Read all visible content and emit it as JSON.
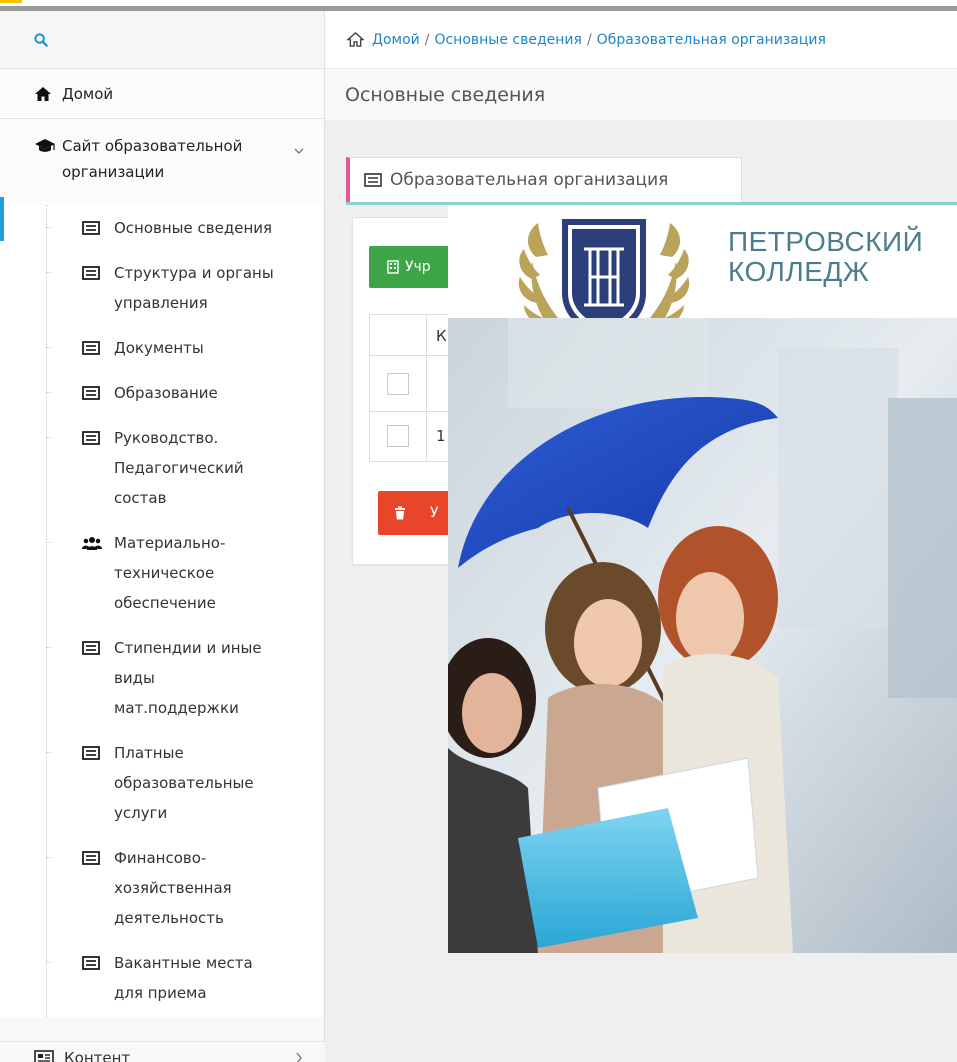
{
  "sidebar": {
    "search_icon": "search-icon",
    "home_label": "Домой",
    "site_label_line1": "Сайт образовательной",
    "site_label_line2": "организации",
    "items": [
      {
        "lines": [
          "Основные сведения"
        ],
        "icon": "list-icon",
        "active": true
      },
      {
        "lines": [
          "Структура и органы",
          "управления"
        ],
        "icon": "list-icon"
      },
      {
        "lines": [
          "Документы"
        ],
        "icon": "list-icon"
      },
      {
        "lines": [
          "Образование"
        ],
        "icon": "list-icon"
      },
      {
        "lines": [
          "Руководство.",
          "Педагогический",
          "состав"
        ],
        "icon": "list-icon"
      },
      {
        "lines": [
          "Материально-",
          "техническое",
          "обеспечение"
        ],
        "icon": "users-icon"
      },
      {
        "lines": [
          "Стипендии и иные",
          "виды",
          "мат.поддержки"
        ],
        "icon": "list-icon"
      },
      {
        "lines": [
          "Платные",
          "образовательные",
          "услуги"
        ],
        "icon": "list-icon"
      },
      {
        "lines": [
          "Финансово-",
          "хозяйственная",
          "деятельность"
        ],
        "icon": "list-icon"
      },
      {
        "lines": [
          "Вакантные места",
          "для приема"
        ],
        "icon": "list-icon"
      }
    ],
    "content_label": "Контент"
  },
  "breadcrumb": {
    "home": "Домой",
    "section": "Основные сведения",
    "current": "Образовательная организация",
    "separator": "/"
  },
  "page_header": "Основные сведения",
  "tab_label": "Образовательная организация",
  "card": {
    "green_button": "Учр",
    "table_header": "К",
    "row_value": "1",
    "red_button": "У"
  },
  "overlay": {
    "college_line1": "ПЕТРОВСКИЙ",
    "college_line2": "КОЛЛЕДЖ"
  },
  "colors": {
    "accent_blue": "#1e9edc",
    "link_blue": "#1f85c9",
    "tab_accent": "#e2569f",
    "green": "#3da547",
    "red": "#e8452b",
    "logo_gold": "#b9a45a",
    "logo_navy": "#2d3f7a"
  }
}
